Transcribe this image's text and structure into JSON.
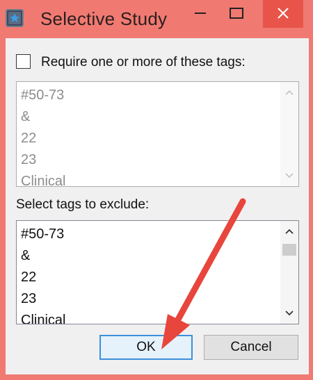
{
  "window": {
    "title": "Selective Study",
    "icon": "app-star-icon",
    "controls": [
      "minimize-icon",
      "maximize-icon",
      "close-icon"
    ]
  },
  "require": {
    "checkbox_label": "Require one or more of these tags:",
    "checked": false,
    "items": [
      "#50-73",
      "&",
      "22",
      "23",
      "Clinical"
    ]
  },
  "exclude": {
    "label": "Select tags to exclude:",
    "items": [
      "#50-73",
      "&",
      "22",
      "23",
      "Clinical"
    ]
  },
  "buttons": {
    "ok": "OK",
    "cancel": "Cancel"
  },
  "colors": {
    "titlebar": "#f07a72",
    "close_hover": "#e8544a",
    "annotation_arrow": "#e8453c",
    "ok_border": "#3c8fdc"
  }
}
